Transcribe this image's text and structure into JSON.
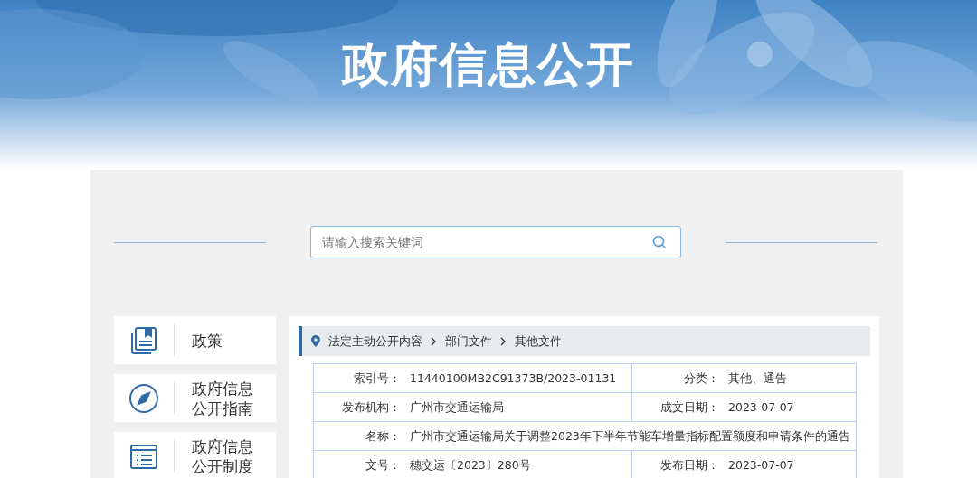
{
  "banner": {
    "title": "政府信息公开"
  },
  "search": {
    "placeholder": "请输入搜索关键词"
  },
  "sidebar": {
    "items": [
      {
        "kind": "book",
        "label": "政策"
      },
      {
        "kind": "compass",
        "label": "政府信息公开指南"
      },
      {
        "kind": "list",
        "label": "政府信息公开制度"
      }
    ]
  },
  "breadcrumb": [
    "法定主动公开内容",
    "部门文件",
    "其他文件"
  ],
  "table": {
    "rows": [
      {
        "kind": "pair",
        "cells": [
          {
            "label": "索引号：",
            "value": "11440100MB2C91373B/2023-01131"
          },
          {
            "label": "分类：",
            "value": "其他、通告"
          }
        ]
      },
      {
        "kind": "pair",
        "cells": [
          {
            "label": "发布机构：",
            "value": "广州市交通运输局"
          },
          {
            "label": "成文日期：",
            "value": "2023-07-07"
          }
        ]
      },
      {
        "kind": "full",
        "cells": [
          {
            "label": "名称：",
            "value": "广州市交通运输局关于调整2023年下半年节能车增量指标配置额度和申请条件的通告"
          }
        ]
      },
      {
        "kind": "pair",
        "cells": [
          {
            "label": "文号：",
            "value": "穗交运〔2023〕280号"
          },
          {
            "label": "发布日期：",
            "value": "2023-07-07"
          }
        ]
      }
    ]
  }
}
